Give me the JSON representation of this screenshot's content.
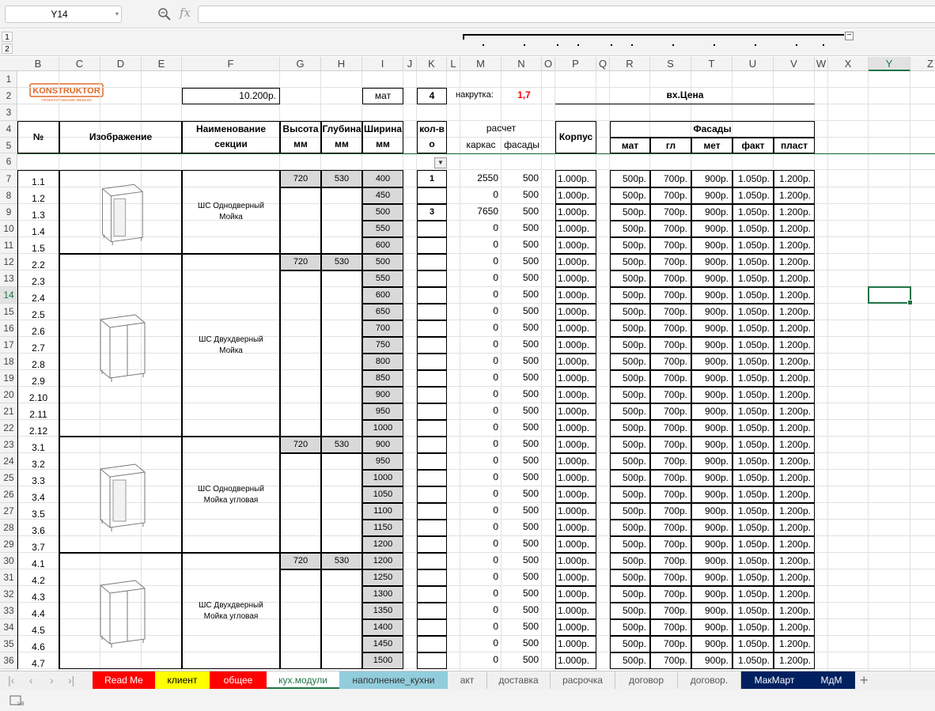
{
  "formula_bar": {
    "name_box": "Y14",
    "fx_label": "fx",
    "formula": ""
  },
  "outline_levels": [
    "1",
    "2"
  ],
  "columns": [
    "B",
    "C",
    "D",
    "E",
    "F",
    "G",
    "H",
    "I",
    "J",
    "K",
    "L",
    "M",
    "N",
    "O",
    "P",
    "Q",
    "R",
    "S",
    "T",
    "U",
    "V",
    "W",
    "X",
    "Y",
    "Z"
  ],
  "selected_column": "Y",
  "rows": [
    "1",
    "2",
    "3",
    "4",
    "5",
    "6",
    "7",
    "8",
    "9",
    "10",
    "11",
    "12",
    "13",
    "14",
    "15",
    "16",
    "17",
    "18",
    "19",
    "20",
    "21",
    "22",
    "23",
    "24",
    "25",
    "26",
    "27",
    "28",
    "29",
    "30",
    "31",
    "32",
    "33",
    "34",
    "35",
    "36"
  ],
  "selected_row": "14",
  "sheet": {
    "logo_text": "KONSTRUKTOR",
    "logo_subtext": "ПРОЕКТИРОВАНИЕ МЕБЕЛИ",
    "price_cell": "10.200р.",
    "material_cell": "мат",
    "count_cell": "4",
    "markup_label": "накрутка:",
    "markup_value": "1,7",
    "vx_price_label": "вх.Цена",
    "headers": {
      "num": "№",
      "image": "Изображение",
      "name": "Наименование секции",
      "height": "Высота мм",
      "depth": "Глубина мм",
      "width": "Ширина мм",
      "qty": "кол-во",
      "calc": "расчет",
      "frame": "каркас",
      "facades_calc": "фасады",
      "body": "Корпус",
      "facades": "Фасады",
      "mat": "мат",
      "gl": "гл",
      "met": "мет",
      "fakt": "факт",
      "plast": "пласт"
    },
    "groups": [
      {
        "name": "ШС Однодверный Мойка",
        "height": "720",
        "depth": "530",
        "image": "single-door-sink-cabinet"
      },
      {
        "name": "ШС Двухдверный Мойка",
        "height": "720",
        "depth": "530",
        "image": "double-door-sink-cabinet"
      },
      {
        "name": "ШС Однодверный Мойка угловая",
        "height": "720",
        "depth": "530",
        "image": "single-door-corner-sink-cabinet"
      },
      {
        "name": "ШС Двухдверный Мойка угловая",
        "height": "720",
        "depth": "530",
        "image": "double-door-corner-sink-cabinet"
      }
    ],
    "items": [
      {
        "num": "1.1",
        "width": "400",
        "qty": "1",
        "frame": "2550",
        "facade": "500",
        "body": "1.000р.",
        "mat": "500р.",
        "gl": "700р.",
        "met": "900р.",
        "fakt": "1.050р.",
        "plast": "1.200р."
      },
      {
        "num": "1.2",
        "width": "450",
        "qty": "",
        "frame": "0",
        "facade": "500",
        "body": "1.000р.",
        "mat": "500р.",
        "gl": "700р.",
        "met": "900р.",
        "fakt": "1.050р.",
        "plast": "1.200р."
      },
      {
        "num": "1.3",
        "width": "500",
        "qty": "3",
        "frame": "7650",
        "facade": "500",
        "body": "1.000р.",
        "mat": "500р.",
        "gl": "700р.",
        "met": "900р.",
        "fakt": "1.050р.",
        "plast": "1.200р."
      },
      {
        "num": "1.4",
        "width": "550",
        "qty": "",
        "frame": "0",
        "facade": "500",
        "body": "1.000р.",
        "mat": "500р.",
        "gl": "700р.",
        "met": "900р.",
        "fakt": "1.050р.",
        "plast": "1.200р."
      },
      {
        "num": "1.5",
        "width": "600",
        "qty": "",
        "frame": "0",
        "facade": "500",
        "body": "1.000р.",
        "mat": "500р.",
        "gl": "700р.",
        "met": "900р.",
        "fakt": "1.050р.",
        "plast": "1.200р."
      },
      {
        "num": "2.2",
        "width": "500",
        "qty": "",
        "frame": "0",
        "facade": "500",
        "body": "1.000р.",
        "mat": "500р.",
        "gl": "700р.",
        "met": "900р.",
        "fakt": "1.050р.",
        "plast": "1.200р."
      },
      {
        "num": "2.3",
        "width": "550",
        "qty": "",
        "frame": "0",
        "facade": "500",
        "body": "1.000р.",
        "mat": "500р.",
        "gl": "700р.",
        "met": "900р.",
        "fakt": "1.050р.",
        "plast": "1.200р."
      },
      {
        "num": "2.4",
        "width": "600",
        "qty": "",
        "frame": "0",
        "facade": "500",
        "body": "1.000р.",
        "mat": "500р.",
        "gl": "700р.",
        "met": "900р.",
        "fakt": "1.050р.",
        "plast": "1.200р."
      },
      {
        "num": "2.5",
        "width": "650",
        "qty": "",
        "frame": "0",
        "facade": "500",
        "body": "1.000р.",
        "mat": "500р.",
        "gl": "700р.",
        "met": "900р.",
        "fakt": "1.050р.",
        "plast": "1.200р."
      },
      {
        "num": "2.6",
        "width": "700",
        "qty": "",
        "frame": "0",
        "facade": "500",
        "body": "1.000р.",
        "mat": "500р.",
        "gl": "700р.",
        "met": "900р.",
        "fakt": "1.050р.",
        "plast": "1.200р."
      },
      {
        "num": "2.7",
        "width": "750",
        "qty": "",
        "frame": "0",
        "facade": "500",
        "body": "1.000р.",
        "mat": "500р.",
        "gl": "700р.",
        "met": "900р.",
        "fakt": "1.050р.",
        "plast": "1.200р."
      },
      {
        "num": "2.8",
        "width": "800",
        "qty": "",
        "frame": "0",
        "facade": "500",
        "body": "1.000р.",
        "mat": "500р.",
        "gl": "700р.",
        "met": "900р.",
        "fakt": "1.050р.",
        "plast": "1.200р."
      },
      {
        "num": "2.9",
        "width": "850",
        "qty": "",
        "frame": "0",
        "facade": "500",
        "body": "1.000р.",
        "mat": "500р.",
        "gl": "700р.",
        "met": "900р.",
        "fakt": "1.050р.",
        "plast": "1.200р."
      },
      {
        "num": "2.10",
        "width": "900",
        "qty": "",
        "frame": "0",
        "facade": "500",
        "body": "1.000р.",
        "mat": "500р.",
        "gl": "700р.",
        "met": "900р.",
        "fakt": "1.050р.",
        "plast": "1.200р."
      },
      {
        "num": "2.11",
        "width": "950",
        "qty": "",
        "frame": "0",
        "facade": "500",
        "body": "1.000р.",
        "mat": "500р.",
        "gl": "700р.",
        "met": "900р.",
        "fakt": "1.050р.",
        "plast": "1.200р."
      },
      {
        "num": "2.12",
        "width": "1000",
        "qty": "",
        "frame": "0",
        "facade": "500",
        "body": "1.000р.",
        "mat": "500р.",
        "gl": "700р.",
        "met": "900р.",
        "fakt": "1.050р.",
        "plast": "1.200р."
      },
      {
        "num": "3.1",
        "width": "900",
        "qty": "",
        "frame": "0",
        "facade": "500",
        "body": "1.000р.",
        "mat": "500р.",
        "gl": "700р.",
        "met": "900р.",
        "fakt": "1.050р.",
        "plast": "1.200р."
      },
      {
        "num": "3.2",
        "width": "950",
        "qty": "",
        "frame": "0",
        "facade": "500",
        "body": "1.000р.",
        "mat": "500р.",
        "gl": "700р.",
        "met": "900р.",
        "fakt": "1.050р.",
        "plast": "1.200р."
      },
      {
        "num": "3.3",
        "width": "1000",
        "qty": "",
        "frame": "0",
        "facade": "500",
        "body": "1.000р.",
        "mat": "500р.",
        "gl": "700р.",
        "met": "900р.",
        "fakt": "1.050р.",
        "plast": "1.200р."
      },
      {
        "num": "3.4",
        "width": "1050",
        "qty": "",
        "frame": "0",
        "facade": "500",
        "body": "1.000р.",
        "mat": "500р.",
        "gl": "700р.",
        "met": "900р.",
        "fakt": "1.050р.",
        "plast": "1.200р."
      },
      {
        "num": "3.5",
        "width": "1100",
        "qty": "",
        "frame": "0",
        "facade": "500",
        "body": "1.000р.",
        "mat": "500р.",
        "gl": "700р.",
        "met": "900р.",
        "fakt": "1.050р.",
        "plast": "1.200р."
      },
      {
        "num": "3.6",
        "width": "1150",
        "qty": "",
        "frame": "0",
        "facade": "500",
        "body": "1.000р.",
        "mat": "500р.",
        "gl": "700р.",
        "met": "900р.",
        "fakt": "1.050р.",
        "plast": "1.200р."
      },
      {
        "num": "3.7",
        "width": "1200",
        "qty": "",
        "frame": "0",
        "facade": "500",
        "body": "1.000р.",
        "mat": "500р.",
        "gl": "700р.",
        "met": "900р.",
        "fakt": "1.050р.",
        "plast": "1.200р."
      },
      {
        "num": "4.1",
        "width": "1200",
        "qty": "",
        "frame": "0",
        "facade": "500",
        "body": "1.000р.",
        "mat": "500р.",
        "gl": "700р.",
        "met": "900р.",
        "fakt": "1.050р.",
        "plast": "1.200р."
      },
      {
        "num": "4.2",
        "width": "1250",
        "qty": "",
        "frame": "0",
        "facade": "500",
        "body": "1.000р.",
        "mat": "500р.",
        "gl": "700р.",
        "met": "900р.",
        "fakt": "1.050р.",
        "plast": "1.200р."
      },
      {
        "num": "4.3",
        "width": "1300",
        "qty": "",
        "frame": "0",
        "facade": "500",
        "body": "1.000р.",
        "mat": "500р.",
        "gl": "700р.",
        "met": "900р.",
        "fakt": "1.050р.",
        "plast": "1.200р."
      },
      {
        "num": "4.4",
        "width": "1350",
        "qty": "",
        "frame": "0",
        "facade": "500",
        "body": "1.000р.",
        "mat": "500р.",
        "gl": "700р.",
        "met": "900р.",
        "fakt": "1.050р.",
        "plast": "1.200р."
      },
      {
        "num": "4.5",
        "width": "1400",
        "qty": "",
        "frame": "0",
        "facade": "500",
        "body": "1.000р.",
        "mat": "500р.",
        "gl": "700р.",
        "met": "900р.",
        "fakt": "1.050р.",
        "plast": "1.200р."
      },
      {
        "num": "4.6",
        "width": "1450",
        "qty": "",
        "frame": "0",
        "facade": "500",
        "body": "1.000р.",
        "mat": "500р.",
        "gl": "700р.",
        "met": "900р.",
        "fakt": "1.050р.",
        "plast": "1.200р."
      },
      {
        "num": "4.7",
        "width": "1500",
        "qty": "",
        "frame": "0",
        "facade": "500",
        "body": "1.000р.",
        "mat": "500р.",
        "gl": "700р.",
        "met": "900р.",
        "fakt": "1.050р.",
        "plast": "1.200р."
      }
    ]
  },
  "tabs": [
    {
      "label": "Read Me",
      "color": "#ff0000",
      "text_color": "#ffffff"
    },
    {
      "label": "клиент",
      "color": "#ffff00",
      "text_color": "#000000"
    },
    {
      "label": "общее",
      "color": "#ff0000",
      "text_color": "#ffffff"
    },
    {
      "label": "кух.модули",
      "color": "#ffffff",
      "text_color": "#217346",
      "active": true
    },
    {
      "label": "наполнение_кухни",
      "color": "#92cddc",
      "text_color": "#333333"
    },
    {
      "label": "акт",
      "color": "#f0f0f0",
      "text_color": "#555555"
    },
    {
      "label": "доставка",
      "color": "#f0f0f0",
      "text_color": "#555555"
    },
    {
      "label": "расрочка",
      "color": "#f0f0f0",
      "text_color": "#555555"
    },
    {
      "label": "договор",
      "color": "#f0f0f0",
      "text_color": "#555555"
    },
    {
      "label": "договор.",
      "color": "#f0f0f0",
      "text_color": "#555555"
    },
    {
      "label": "МакМарт",
      "color": "#002060",
      "text_color": "#ffffff"
    },
    {
      "label": "МдМ",
      "color": "#002060",
      "text_color": "#ffffff"
    }
  ],
  "colors": {
    "accent": "#217346",
    "grid": "#e1e1e1",
    "markup_value": "#ff0000"
  }
}
